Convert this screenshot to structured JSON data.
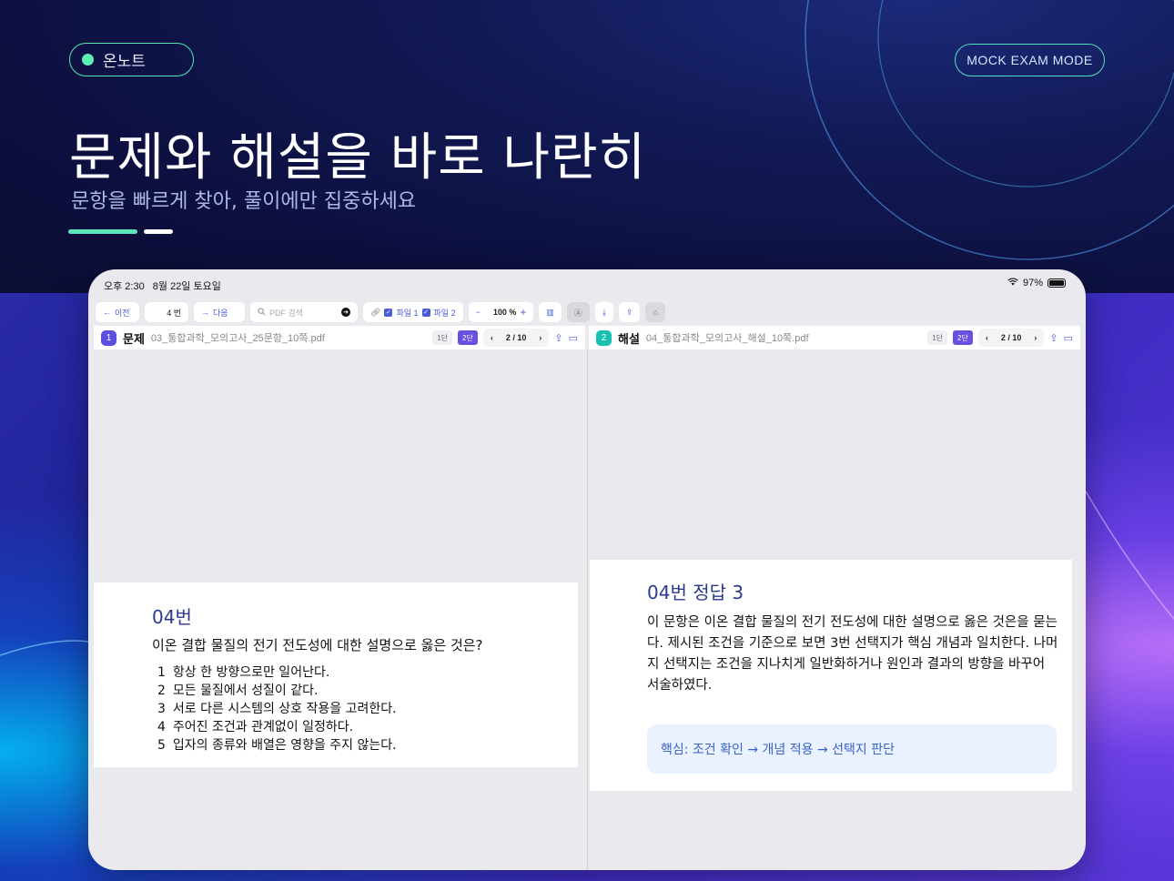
{
  "brand": {
    "name": "온노트",
    "dot_color": "#5cf0b4"
  },
  "mode_label": "MOCK EXAM MODE",
  "hero": {
    "title": "문제와 해설을 바로 나란히",
    "subtitle": "문항을 빠르게 찾아, 풀이에만 집중하세요"
  },
  "status_bar": {
    "time": "오후 2:30",
    "date": "8월 22일 토요일",
    "battery": "97%",
    "battery_level": 0.97
  },
  "toolbar": {
    "prev_label": "이전",
    "page_label": "4 번",
    "next_label": "다음",
    "search_placeholder": "PDF 검색",
    "file1_label": "파일 1",
    "file2_label": "파일 2",
    "zoom_minus": "−",
    "zoom_value": "100 %",
    "zoom_plus": "+"
  },
  "left_panel": {
    "index": "1",
    "title": "문제",
    "file_name": "03_통합과학_모의고사_25문항_10쪽.pdf",
    "col1": "1단",
    "col2": "2단",
    "page_indicator": "2 / 10",
    "accent": "#5a4fe0"
  },
  "right_panel": {
    "index": "2",
    "title": "해설",
    "file_name": "04_통합과학_모의고사_해설_10쪽.pdf",
    "col1": "1단",
    "col2": "2단",
    "page_indicator": "2 / 10",
    "accent": "#19c2b0"
  },
  "question": {
    "number": "04번",
    "text": "이온 결합 물질의 전기 전도성에 대한 설명으로 옳은 것은?",
    "choices": [
      {
        "num": "1",
        "text": "항상 한 방향으로만 일어난다."
      },
      {
        "num": "2",
        "text": "모든 물질에서 성질이 같다."
      },
      {
        "num": "3",
        "text": "서로 다른 시스템의 상호 작용을 고려한다."
      },
      {
        "num": "4",
        "text": "주어진 조건과 관계없이 일정하다."
      },
      {
        "num": "5",
        "text": "입자의 종류와 배열은 영향을 주지 않는다."
      }
    ]
  },
  "answer": {
    "title": "04번 정답 3",
    "body": "이 문항은 이온 결합 물질의 전기 전도성에 대한 설명으로 옳은 것은을 묻는다. 제시된 조건을 기준으로 보면 3번 선택지가 핵심 개념과 일치한다. 나머지 선택지는 조건을 지나치게 일반화하거나 원인과 결과의 방향을 바꾸어 서술하였다.",
    "key_point": "핵심: 조건 확인 → 개념 적용 → 선택지 판단"
  }
}
